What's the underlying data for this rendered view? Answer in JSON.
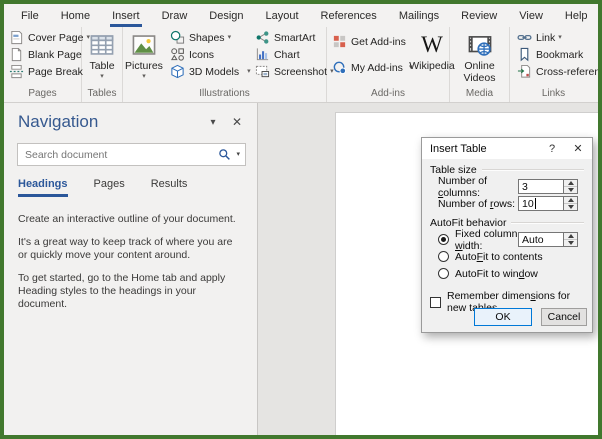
{
  "menu_bar": {
    "tabs": [
      "File",
      "Home",
      "Insert",
      "Draw",
      "Design",
      "Layout",
      "References",
      "Mailings",
      "Review",
      "View",
      "Help"
    ],
    "active_tab": "Insert"
  },
  "ribbon": {
    "groups": [
      {
        "label": "Pages",
        "items": [
          "Cover Page",
          "Blank Page",
          "Page Break"
        ]
      },
      {
        "label": "Tables",
        "items": [
          "Table"
        ]
      },
      {
        "label": "Illustrations",
        "items": [
          "Pictures",
          "Shapes",
          "Icons",
          "3D Models",
          "SmartArt",
          "Chart",
          "Screenshot"
        ]
      },
      {
        "label": "Add-ins",
        "items": [
          "Get Add-ins",
          "My Add-ins",
          "Wikipedia"
        ]
      },
      {
        "label": "Media",
        "items": [
          "Online Videos"
        ]
      },
      {
        "label": "Links",
        "items": [
          "Link",
          "Bookmark",
          "Cross-reference"
        ]
      }
    ]
  },
  "navigation_pane": {
    "title": "Navigation",
    "search": {
      "placeholder": "Search document",
      "value": ""
    },
    "tabs": [
      "Headings",
      "Pages",
      "Results"
    ],
    "active_tab": "Headings",
    "body_paragraphs": [
      "Create an interactive outline of your document.",
      "It's a great way to keep track of where you are or quickly move your content around.",
      "To get started, go to the Home tab and apply Heading styles to the headings in your document."
    ]
  },
  "insert_table_dialog": {
    "title": "Insert Table",
    "table_size_header": "Table size",
    "autofit_header": "AutoFit behavior",
    "columns_label": {
      "pre": "Number of ",
      "key": "c",
      "post": "olumns:"
    },
    "columns_value": "3",
    "rows_label": {
      "pre": "Number of ",
      "key": "r",
      "post": "ows:"
    },
    "rows_value": "10",
    "fixed_width_label": {
      "pre": "Fixed column ",
      "key": "w",
      "post": "idth:"
    },
    "fixed_width_value": "Auto",
    "autofit_contents_label": {
      "pre": "Auto",
      "key": "F",
      "post": "it to contents"
    },
    "autofit_window_label": {
      "pre": "AutoFit to win",
      "key": "d",
      "post": "ow"
    },
    "remember_label": {
      "pre": "Remember dimen",
      "key": "s",
      "post": "ions for new tables"
    },
    "selected_option": "Fixed column width",
    "remember_checked": false,
    "ok_label": "OK",
    "cancel_label": "Cancel"
  },
  "icons": {
    "dropdown_glyph": "▾",
    "pane_menu_glyph": "▾",
    "close_glyph": "✕",
    "help_glyph": "?",
    "wikipedia_glyph": "W"
  },
  "colors": {
    "accent_blue": "#2b579a",
    "frame_green": "#41782e",
    "ok_border": "#0078d7"
  }
}
